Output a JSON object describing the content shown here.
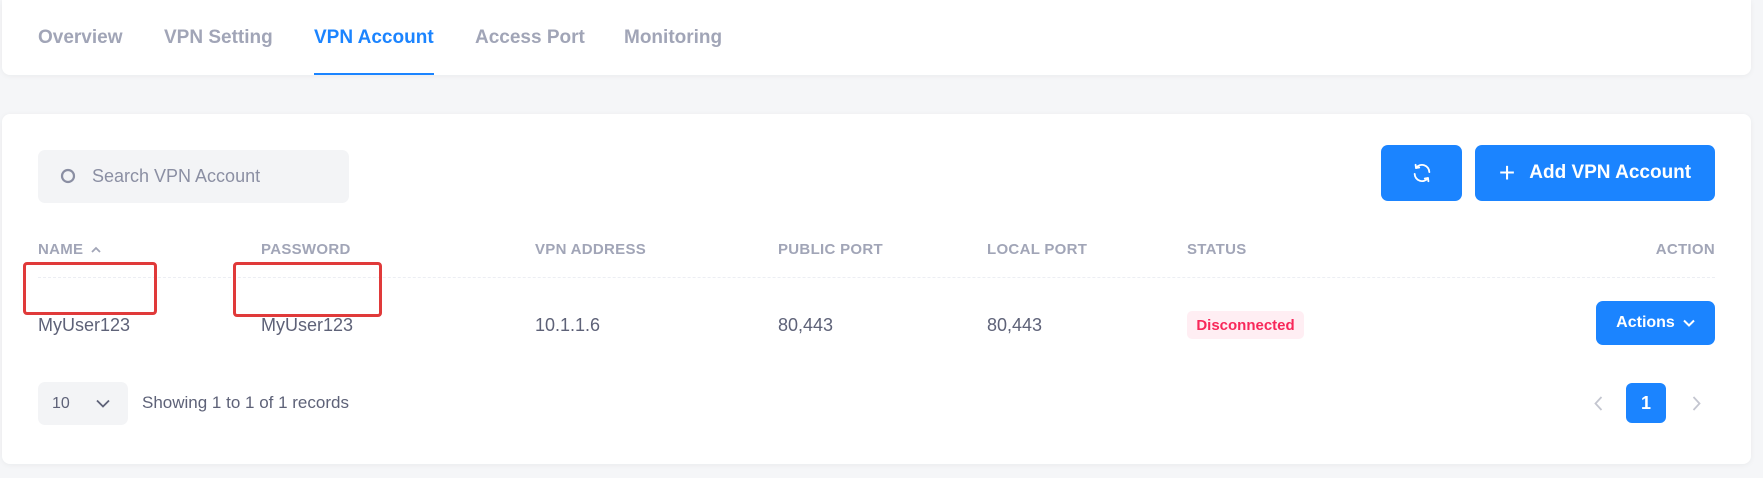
{
  "tabs": [
    {
      "label": "Overview",
      "active": false
    },
    {
      "label": "VPN Setting",
      "active": false
    },
    {
      "label": "VPN Account",
      "active": true
    },
    {
      "label": "Access Port",
      "active": false
    },
    {
      "label": "Monitoring",
      "active": false
    }
  ],
  "search": {
    "placeholder": "Search VPN Account",
    "value": ""
  },
  "toolbar": {
    "refresh_icon": "refresh-icon",
    "add_label": "Add VPN Account",
    "add_icon": "+"
  },
  "table": {
    "columns": [
      "NAME",
      "PASSWORD",
      "VPN ADDRESS",
      "PUBLIC PORT",
      "LOCAL PORT",
      "STATUS",
      "ACTION"
    ],
    "rows": [
      {
        "name": "MyUser123",
        "password": "MyUser123",
        "vpn_address": "10.1.1.6",
        "public_port": "80,443",
        "local_port": "80,443",
        "status": "Disconnected",
        "action_label": "Actions"
      }
    ]
  },
  "pagination": {
    "page_size": "10",
    "info": "Showing 1 to 1 of 1 records",
    "current_page": "1"
  },
  "colors": {
    "primary": "#1b84ff",
    "danger": "#f8285a",
    "danger_bg": "#ffeef3",
    "highlight": "#e03a3a"
  }
}
